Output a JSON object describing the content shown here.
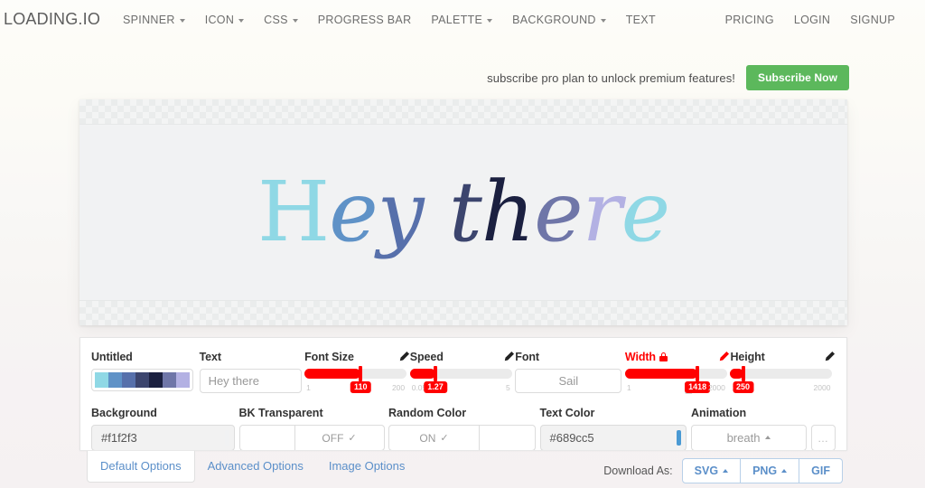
{
  "navbar": {
    "brand": "LOADING.IO",
    "left_items": [
      {
        "label": "SPINNER",
        "caret": true
      },
      {
        "label": "ICON",
        "caret": true
      },
      {
        "label": "CSS",
        "caret": true
      },
      {
        "label": "PROGRESS BAR",
        "caret": false
      },
      {
        "label": "PALETTE",
        "caret": true
      },
      {
        "label": "BACKGROUND",
        "caret": true
      },
      {
        "label": "TEXT",
        "caret": false
      }
    ],
    "right_items": [
      {
        "label": "PRICING"
      },
      {
        "label": "LOGIN"
      },
      {
        "label": "SIGNUP"
      }
    ]
  },
  "promo": {
    "text": "subscribe pro plan to unlock premium features!",
    "button": "Subscribe Now",
    "button_color": "#5cb85c"
  },
  "preview": {
    "background": "#f1f2f3",
    "letters": [
      {
        "ch": "H",
        "color": "#8fd8e5"
      },
      {
        "ch": "e",
        "color": "#5f92c7"
      },
      {
        "ch": "y",
        "color": "#5770ab"
      },
      {
        "ch": " ",
        "color": "#000000"
      },
      {
        "ch": "t",
        "color": "#3c456e"
      },
      {
        "ch": "h",
        "color": "#1b2040"
      },
      {
        "ch": "e",
        "color": "#6f76a8"
      },
      {
        "ch": "r",
        "color": "#b3b1e3"
      },
      {
        "ch": "e",
        "color": "#8fd8e5"
      }
    ]
  },
  "panel": {
    "title_field": {
      "label": "Untitled",
      "palette": [
        "#8fd8e5",
        "#5f92c7",
        "#5770ab",
        "#3c456e",
        "#1b2040",
        "#6f76a8",
        "#b3b1e3"
      ]
    },
    "text_field": {
      "label": "Text",
      "value": "Hey there",
      "placeholder": "Hey there"
    },
    "font_size": {
      "label": "Font Size",
      "value": "110",
      "min": "1",
      "max": "200",
      "percent": 55
    },
    "speed": {
      "label": "Speed",
      "value": "1.27",
      "min": "0.05",
      "max": "5",
      "percent": 25
    },
    "font": {
      "label": "Font",
      "value": "Sail",
      "placeholder": "Sail"
    },
    "width": {
      "label": "Width",
      "value": "1418",
      "min": "1",
      "max": "2000",
      "percent": 71,
      "locked": true,
      "lock_marker": "▪",
      "accent": "#ff0000"
    },
    "height": {
      "label": "Height",
      "value": "250",
      "min": "1",
      "max": "2000",
      "percent": 12.5
    },
    "background": {
      "label": "Background",
      "value": "#f1f2f3",
      "swatch": "#f1f2f3"
    },
    "bk_transparent": {
      "label": "BK Transparent",
      "value": "OFF"
    },
    "random_color": {
      "label": "Random Color",
      "value": "ON"
    },
    "text_color": {
      "label": "Text Color",
      "value": "#689cc5",
      "swatch": "#4a9ad4"
    },
    "animation": {
      "label": "Animation",
      "value": "breath",
      "more": "…"
    }
  },
  "tabs": [
    {
      "label": "Default Options",
      "active": true
    },
    {
      "label": "Advanced Options",
      "active": false
    },
    {
      "label": "Image Options",
      "active": false
    }
  ],
  "download": {
    "label": "Download As:",
    "buttons": [
      {
        "label": "SVG",
        "caret": true
      },
      {
        "label": "PNG",
        "caret": true
      },
      {
        "label": "GIF",
        "caret": false
      }
    ]
  }
}
